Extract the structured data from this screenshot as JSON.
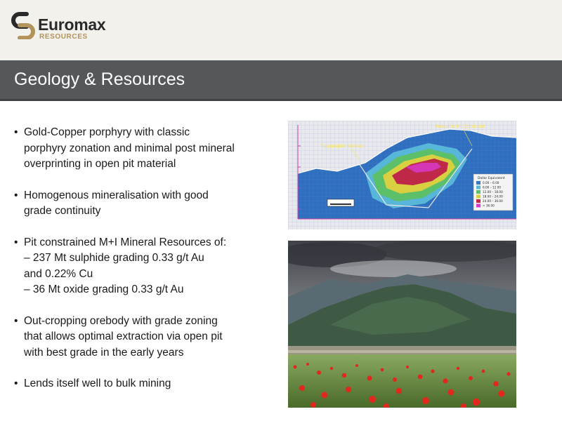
{
  "brand": {
    "name": "Euromax",
    "sub": "RESOURCES",
    "colors": {
      "dark": "#2a2a2a",
      "gold": "#b3935c"
    }
  },
  "header": {
    "title": "Geology & Resources"
  },
  "bullets": [
    {
      "lines": [
        "Gold-Copper porphyry with classic",
        "porphyry zonation and minimal post mineral",
        "overprinting in open pit material"
      ]
    },
    {
      "lines": [
        "Homogenous mineralisation with good",
        "grade continuity"
      ]
    },
    {
      "lines": [
        "Pit constrained M+I Mineral Resources of:",
        "– 237 Mt sulphide grading 0.33 g/t Au",
        "and 0.22% Cu",
        "– 36 Mt oxide grading 0.33 g/t Au"
      ]
    },
    {
      "lines": [
        "Out-cropping orebody with grade zoning",
        "that allows optimal extraction via open pit",
        "with best grade in the early years"
      ]
    },
    {
      "lines": [
        "Lends itself well to bulk mining"
      ]
    }
  ],
  "section_figure": {
    "label_pit": "Resource Pit Constraint",
    "label_topo": "Topographic Surface",
    "legend_title": "Dollar Equivalent",
    "legend": [
      {
        "label": "0.00 – 6.00",
        "color": "#3a78c8"
      },
      {
        "label": "6.00 – 12.00",
        "color": "#58b6d8"
      },
      {
        "label": "12.00 – 18.00",
        "color": "#5cc06a"
      },
      {
        "label": "18.00 – 24.00",
        "color": "#d8d040"
      },
      {
        "label": "24.00 – 36.00",
        "color": "#c0284a"
      },
      {
        "label": "> 36.00",
        "color": "#d83ad0"
      }
    ]
  }
}
